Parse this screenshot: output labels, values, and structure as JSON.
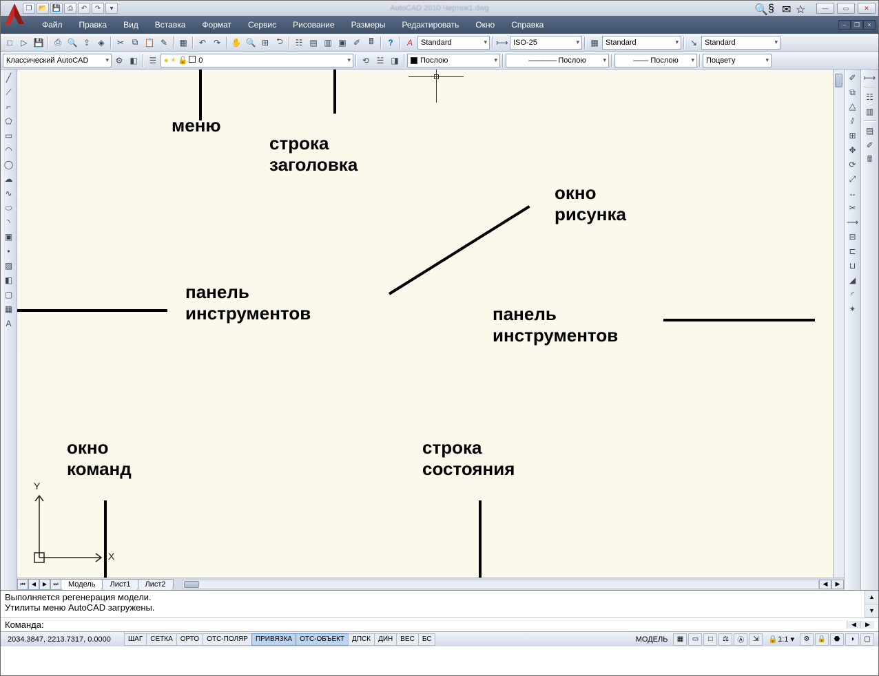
{
  "title": "AutoCAD 2010 Чертеж1.dwg",
  "menubar": [
    "Файл",
    "Правка",
    "Вид",
    "Вставка",
    "Формат",
    "Сервис",
    "Рисование",
    "Размеры",
    "Редактировать",
    "Окно",
    "Справка"
  ],
  "toolbar1": {
    "text_style": "Standard",
    "dim_style": "ISO-25",
    "table_style": "Standard",
    "mleader_style": "Standard"
  },
  "toolbar2": {
    "workspace": "Классический AutoCAD",
    "layer": "0",
    "linetype": "Послою",
    "lineweight": "Послою",
    "plotstyle": "Послою",
    "color": "Поцвету"
  },
  "left_tools": [
    "line",
    "xline",
    "polyline",
    "polygon",
    "rectangle",
    "arc",
    "circle",
    "revcloud",
    "spline",
    "ellipse",
    "ellipse-arc",
    "block",
    "point",
    "hatch",
    "gradient",
    "region",
    "table",
    "text"
  ],
  "right_tools_a": [
    "erase",
    "copy",
    "mirror",
    "offset",
    "array",
    "move",
    "rotate",
    "scale",
    "stretch",
    "trim",
    "extend",
    "break-pt",
    "break",
    "join",
    "chamfer",
    "fillet",
    "explode"
  ],
  "right_tools_b": [
    "dist",
    "props",
    "tool-pal",
    "sheet",
    "markup",
    "calc"
  ],
  "sheet_tabs": [
    "Модель",
    "Лист1",
    "Лист2"
  ],
  "cmd_log": "Выполняется регенерация модели.\nУтилиты меню AutoCAD загружены.",
  "cmd_prompt": "Команда:",
  "status": {
    "coords": "2034.3847, 2213.7317, 0.0000",
    "toggles": [
      "ШАГ",
      "СЕТКА",
      "ОРТО",
      "ОТС-ПОЛЯР",
      "ПРИВЯЗКА",
      "ОТС-ОБЪЕКТ",
      "ДПСК",
      "ДИН",
      "ВЕС",
      "БС"
    ],
    "active": [
      4,
      5
    ],
    "space": "МОДЕЛЬ",
    "scale": "1:1"
  },
  "ucs": {
    "x": "X",
    "y": "Y"
  },
  "annotations": {
    "menu": "меню",
    "titlebar": "строка\nзаголовка",
    "drawarea": "окно\nрисунка",
    "toolpanel_l": "панель\nинструментов",
    "toolpanel_r": "панель\nинструментов",
    "cmdwin": "окно\nкоманд",
    "statusbar": "строка\nсостояния"
  }
}
